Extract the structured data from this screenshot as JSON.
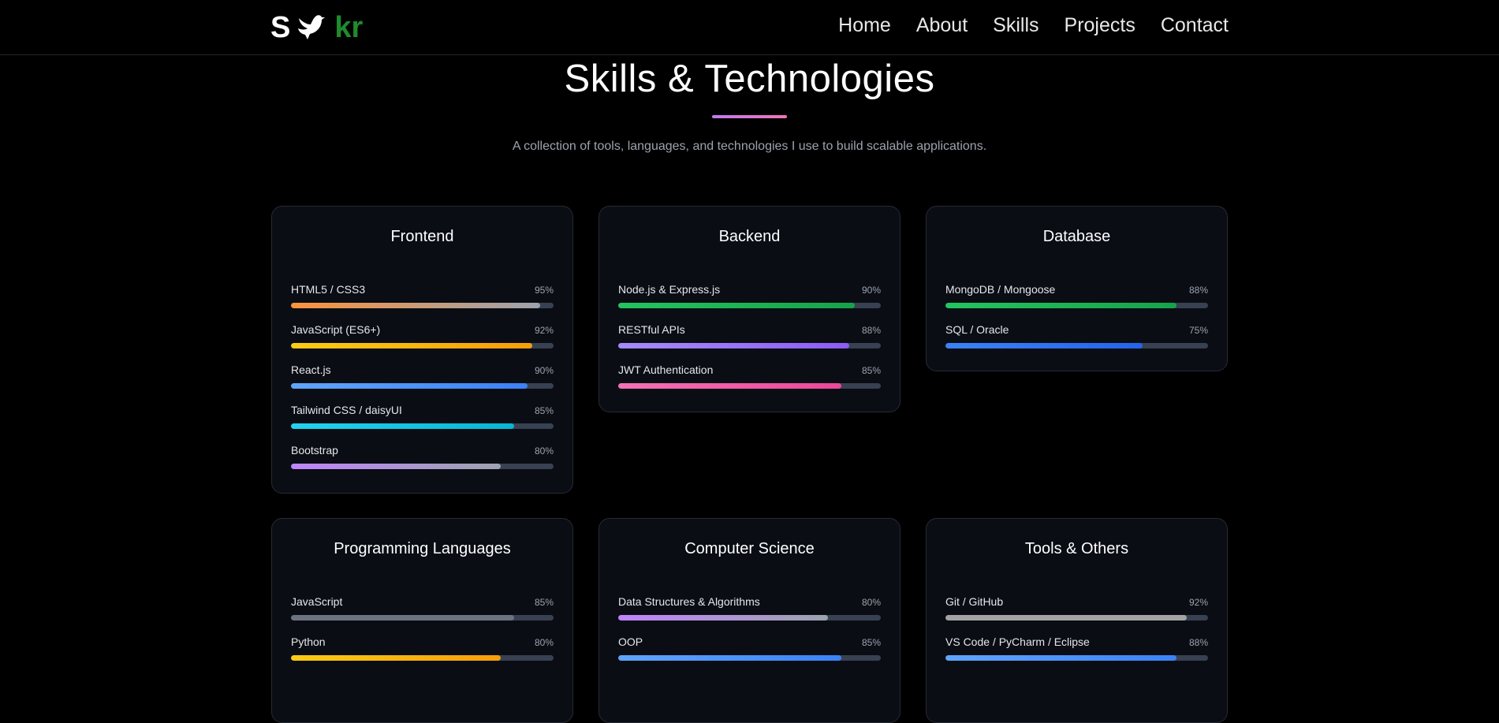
{
  "header": {
    "logo_left": "S",
    "logo_right": "kr",
    "logo_icon": "dove-icon",
    "nav": [
      "Home",
      "About",
      "Skills",
      "Projects",
      "Contact"
    ]
  },
  "section": {
    "title": "Skills & Technologies",
    "subtitle": "A collection of tools, languages, and technologies I use to build scalable applications."
  },
  "categories": [
    {
      "title": "Frontend",
      "skills": [
        {
          "name": "HTML5 / CSS3",
          "percent": "95%",
          "level": 95,
          "colors": [
            "#fb923c",
            "#9ca3af"
          ]
        },
        {
          "name": "JavaScript (ES6+)",
          "percent": "92%",
          "level": 92,
          "colors": [
            "#facc15",
            "#f59e0b"
          ]
        },
        {
          "name": "React.js",
          "percent": "90%",
          "level": 90,
          "colors": [
            "#60a5fa",
            "#3b82f6"
          ]
        },
        {
          "name": "Tailwind CSS / daisyUI",
          "percent": "85%",
          "level": 85,
          "colors": [
            "#22d3ee",
            "#06b6d4"
          ]
        },
        {
          "name": "Bootstrap",
          "percent": "80%",
          "level": 80,
          "colors": [
            "#c084fc",
            "#9ca3af"
          ]
        }
      ]
    },
    {
      "title": "Backend",
      "skills": [
        {
          "name": "Node.js & Express.js",
          "percent": "90%",
          "level": 90,
          "colors": [
            "#22c55e",
            "#16a34a"
          ]
        },
        {
          "name": "RESTful APIs",
          "percent": "88%",
          "level": 88,
          "colors": [
            "#a78bfa",
            "#8b5cf6"
          ]
        },
        {
          "name": "JWT Authentication",
          "percent": "85%",
          "level": 85,
          "colors": [
            "#f472b6",
            "#ec4899"
          ]
        }
      ]
    },
    {
      "title": "Database",
      "skills": [
        {
          "name": "MongoDB / Mongoose",
          "percent": "88%",
          "level": 88,
          "colors": [
            "#22c55e",
            "#16a34a"
          ]
        },
        {
          "name": "SQL / Oracle",
          "percent": "75%",
          "level": 75,
          "colors": [
            "#3b82f6",
            "#2563eb"
          ]
        }
      ]
    },
    {
      "title": "Programming Languages",
      "skills": [
        {
          "name": "JavaScript",
          "percent": "85%",
          "level": 85,
          "colors": [
            "#6b7280",
            "#6b7280"
          ]
        },
        {
          "name": "Python",
          "percent": "80%",
          "level": 80,
          "colors": [
            "#facc15",
            "#f59e0b"
          ]
        }
      ]
    },
    {
      "title": "Computer Science",
      "skills": [
        {
          "name": "Data Structures & Algorithms",
          "percent": "80%",
          "level": 80,
          "colors": [
            "#c084fc",
            "#9ca3af"
          ]
        },
        {
          "name": "OOP",
          "percent": "85%",
          "level": 85,
          "colors": [
            "#60a5fa",
            "#3b82f6"
          ]
        }
      ]
    },
    {
      "title": "Tools & Others",
      "skills": [
        {
          "name": "Git / GitHub",
          "percent": "92%",
          "level": 92,
          "colors": [
            "#a3a3a3",
            "#a3a3a3"
          ]
        },
        {
          "name": "VS Code / PyCharm / Eclipse",
          "percent": "88%",
          "level": 88,
          "colors": [
            "#60a5fa",
            "#3b82f6"
          ]
        }
      ]
    }
  ]
}
